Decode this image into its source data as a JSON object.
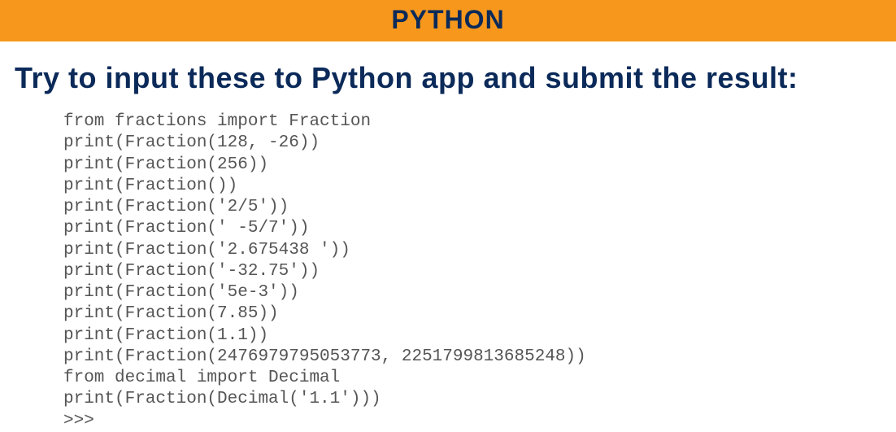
{
  "header": {
    "title": "PYTHON"
  },
  "instruction": "Try to input these to Python app and submit the result:",
  "code_lines": [
    "from fractions import Fraction",
    "print(Fraction(128, -26))",
    "print(Fraction(256))",
    "print(Fraction())",
    "print(Fraction('2/5'))",
    "print(Fraction(' -5/7'))",
    "print(Fraction('2.675438 '))",
    "print(Fraction('-32.75'))",
    "print(Fraction('5e-3'))",
    "print(Fraction(7.85))",
    "print(Fraction(1.1))",
    "print(Fraction(2476979795053773, 2251799813685248))",
    "from decimal import Decimal",
    "print(Fraction(Decimal('1.1')))",
    ">>>"
  ]
}
